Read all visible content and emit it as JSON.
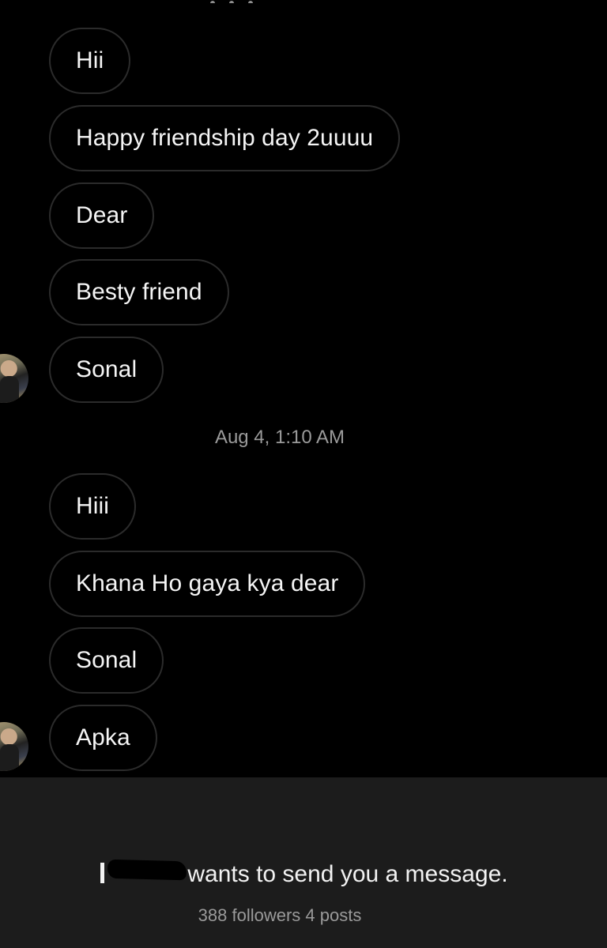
{
  "thread": {
    "group_one": [
      {
        "text": "Hii"
      },
      {
        "text": "Happy friendship day 2uuuu"
      },
      {
        "text": "Dear"
      },
      {
        "text": "Besty friend"
      },
      {
        "text": "Sonal"
      }
    ],
    "timestamp": "Aug 4, 1:10 AM",
    "group_two": [
      {
        "text": "Hiii"
      },
      {
        "text": "Khana Ho gaya kya dear"
      },
      {
        "text": "Sonal"
      },
      {
        "text": "Apka"
      }
    ]
  },
  "message_request": {
    "sender_name_redacted": true,
    "request_text": "wants to send you a message.",
    "stats": "388 followers 4 posts"
  }
}
